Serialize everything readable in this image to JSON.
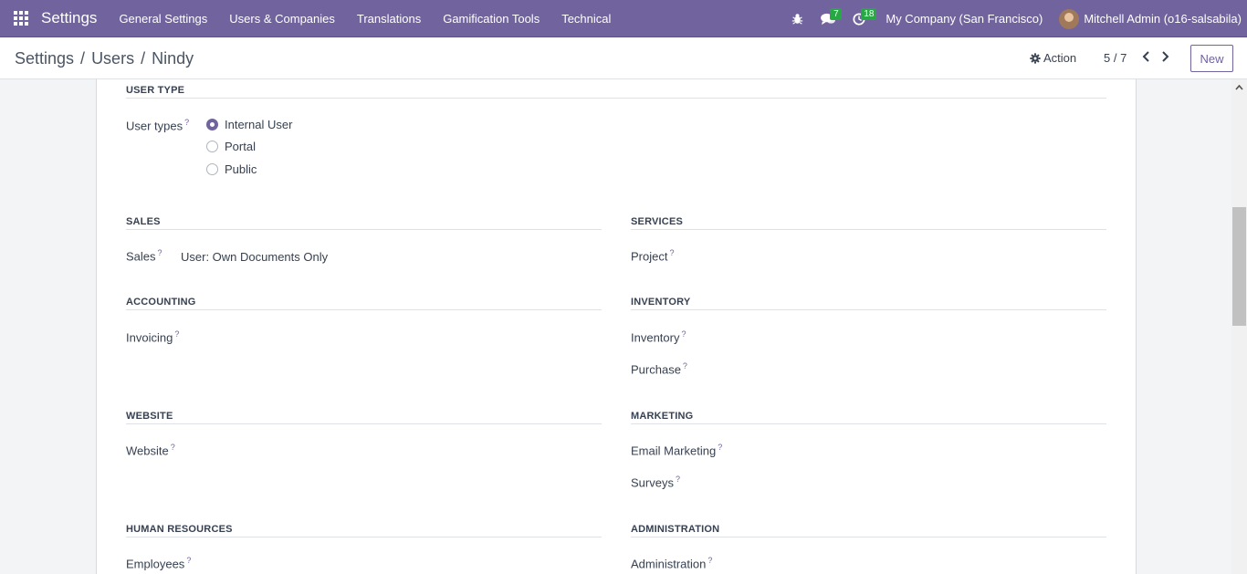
{
  "navbar": {
    "brand": "Settings",
    "menu": [
      "General Settings",
      "Users & Companies",
      "Translations",
      "Gamification Tools",
      "Technical"
    ],
    "messages_count": "7",
    "activities_count": "18",
    "company": "My Company (San Francisco)",
    "user": "Mitchell Admin (o16-salsabila)"
  },
  "breadcrumb": {
    "settings": "Settings",
    "users": "Users",
    "current": "Nindy",
    "separator": "/"
  },
  "control": {
    "action_label": "Action",
    "pager": "5 / 7",
    "new_label": "New"
  },
  "form": {
    "user_type": {
      "title": "USER TYPE",
      "label": "User types",
      "options": [
        "Internal User",
        "Portal",
        "Public"
      ],
      "selected": "Internal User"
    },
    "sales": {
      "title": "SALES",
      "label": "Sales",
      "value": "User: Own Documents Only"
    },
    "services": {
      "title": "SERVICES",
      "label": "Project"
    },
    "accounting": {
      "title": "ACCOUNTING",
      "label": "Invoicing"
    },
    "inventory": {
      "title": "INVENTORY",
      "labels": [
        "Inventory",
        "Purchase"
      ]
    },
    "website": {
      "title": "WEBSITE",
      "label": "Website"
    },
    "marketing": {
      "title": "MARKETING",
      "labels": [
        "Email Marketing",
        "Surveys"
      ]
    },
    "hr": {
      "title": "HUMAN RESOURCES",
      "label": "Employees"
    },
    "administration": {
      "title": "ADMINISTRATION",
      "label": "Administration"
    },
    "help_mark": "?"
  },
  "colors": {
    "brand": "#71639e",
    "badge": "#28a745"
  }
}
